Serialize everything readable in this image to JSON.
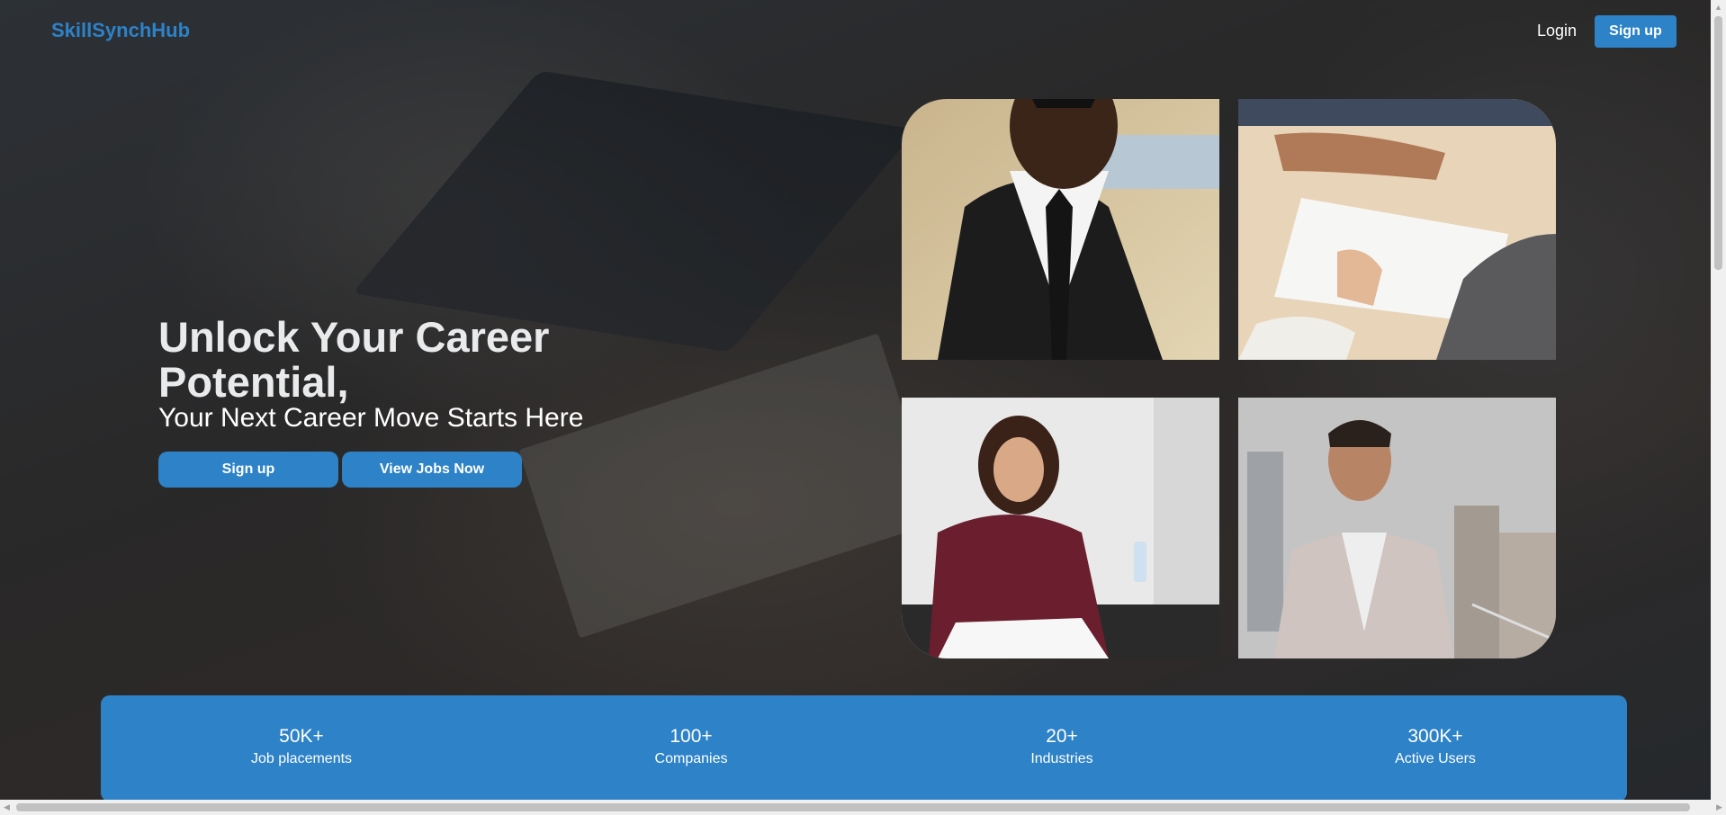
{
  "header": {
    "brand": "SkillSynchHub",
    "login_label": "Login",
    "signup_label": "Sign up"
  },
  "hero": {
    "title": "Unlock Your Career Potential,",
    "subtitle": "Your Next Career Move Starts Here",
    "signup_label": "Sign up",
    "view_jobs_label": "View Jobs Now"
  },
  "gallery": {
    "images": [
      {
        "name": "man-in-suit-photo"
      },
      {
        "name": "meeting-documents-photo"
      },
      {
        "name": "woman-signing-documents-photo"
      },
      {
        "name": "man-on-balcony-photo"
      }
    ]
  },
  "stats": [
    {
      "value": "50K+",
      "label": "Job placements"
    },
    {
      "value": "100+",
      "label": "Companies"
    },
    {
      "value": "20+",
      "label": "Industries"
    },
    {
      "value": "300K+",
      "label": "Active Users"
    }
  ],
  "colors": {
    "accent": "#2d82c8",
    "text_light": "#ffffff"
  }
}
